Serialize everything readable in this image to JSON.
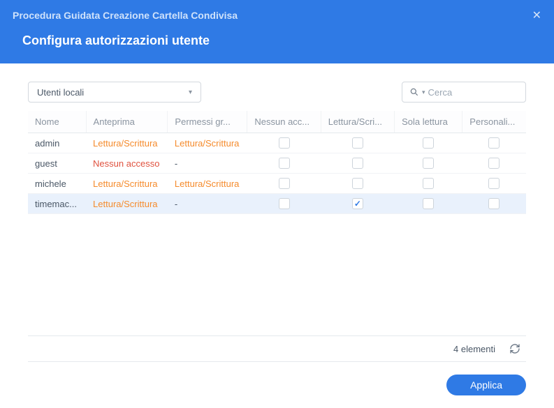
{
  "window": {
    "title": "Procedura Guidata Creazione Cartella Condivisa",
    "subtitle": "Configura autorizzazioni utente"
  },
  "toolbar": {
    "user_filter": "Utenti locali",
    "search_placeholder": "Cerca"
  },
  "columns": {
    "name": "Nome",
    "preview": "Anteprima",
    "group_perms": "Permessi gr...",
    "no_access": "Nessun acc...",
    "read_write": "Lettura/Scri...",
    "read_only": "Sola lettura",
    "custom": "Personali..."
  },
  "rows": [
    {
      "name": "admin",
      "preview": "Lettura/Scrittura",
      "preview_class": "orange",
      "group": "Lettura/Scrittura",
      "group_class": "orange",
      "na": false,
      "rw": false,
      "ro": false,
      "cu": false,
      "selected": false
    },
    {
      "name": "guest",
      "preview": "Nessun accesso",
      "preview_class": "red",
      "group": "-",
      "group_class": "",
      "na": false,
      "rw": false,
      "ro": false,
      "cu": false,
      "selected": false
    },
    {
      "name": "michele",
      "preview": "Lettura/Scrittura",
      "preview_class": "orange",
      "group": "Lettura/Scrittura",
      "group_class": "orange",
      "na": false,
      "rw": false,
      "ro": false,
      "cu": false,
      "selected": false
    },
    {
      "name": "timemac...",
      "preview": "Lettura/Scrittura",
      "preview_class": "orange",
      "group": "-",
      "group_class": "",
      "na": false,
      "rw": true,
      "ro": false,
      "cu": false,
      "selected": true
    }
  ],
  "footer": {
    "count_text": "4 elementi"
  },
  "actions": {
    "apply": "Applica"
  }
}
